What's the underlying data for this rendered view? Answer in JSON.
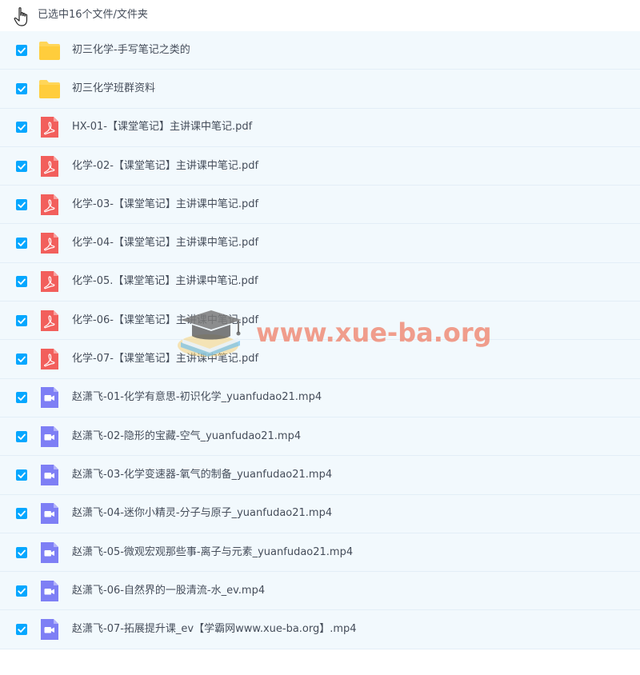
{
  "header": {
    "selection_text": "已选中16个文件/文件夹"
  },
  "files": [
    {
      "name": "初三化学-手写笔记之类的",
      "type": "folder"
    },
    {
      "name": "初三化学班群资料",
      "type": "folder"
    },
    {
      "name": "HX-01-【课堂笔记】主讲课中笔记.pdf",
      "type": "pdf"
    },
    {
      "name": "化学-02-【课堂笔记】主讲课中笔记.pdf",
      "type": "pdf"
    },
    {
      "name": "化学-03-【课堂笔记】主讲课中笔记.pdf",
      "type": "pdf"
    },
    {
      "name": "化学-04-【课堂笔记】主讲课中笔记.pdf",
      "type": "pdf"
    },
    {
      "name": "化学-05.【课堂笔记】主讲课中笔记.pdf",
      "type": "pdf"
    },
    {
      "name": "化学-06-【课堂笔记】主讲课中笔记.pdf",
      "type": "pdf"
    },
    {
      "name": "化学-07-【课堂笔记】主讲课中笔记.pdf",
      "type": "pdf"
    },
    {
      "name": "赵潇飞-01-化学有意思-初识化学_yuanfudao21.mp4",
      "type": "video"
    },
    {
      "name": "赵潇飞-02-隐形的宝藏-空气_yuanfudao21.mp4",
      "type": "video"
    },
    {
      "name": "赵潇飞-03-化学变速器-氧气的制备_yuanfudao21.mp4",
      "type": "video"
    },
    {
      "name": "赵潇飞-04-迷你小精灵-分子与原子_yuanfudao21.mp4",
      "type": "video"
    },
    {
      "name": "赵潇飞-05-微观宏观那些事-离子与元素_yuanfudao21.mp4",
      "type": "video"
    },
    {
      "name": "赵潇飞-06-自然界的一股清流-水_ev.mp4",
      "type": "video"
    },
    {
      "name": "赵潇飞-07-拓展提升课_ev【学霸网www.xue-ba.org】.mp4",
      "type": "video"
    }
  ],
  "watermark": {
    "text": "www.xue-ba.org"
  },
  "colors": {
    "checkbox": "#06a7ff",
    "folder": "#ffd659",
    "pdf": "#f25f5c",
    "video": "#7e7ff5",
    "row_background": "#f2f9fd"
  }
}
